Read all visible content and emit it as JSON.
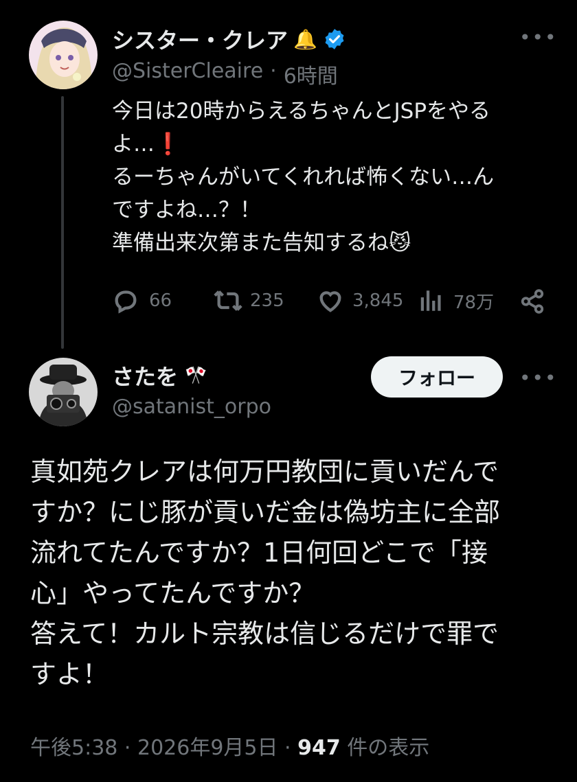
{
  "tweet1": {
    "author_name": "シスター・クレア",
    "name_emoji": "🔔",
    "verified": true,
    "handle": "@SisterCleaire",
    "separator": "·",
    "time": "6時間",
    "text_lines": [
      "今日は20時からえるちゃんとJSPをやる",
      "よ…❗",
      "るーちゃんがいてくれれば怖くない…ん",
      "ですよね…？！",
      "準備出来次第また告知するね😼"
    ],
    "stats": {
      "replies": "66",
      "retweets": "235",
      "likes": "3,845",
      "views": "78万"
    }
  },
  "tweet2": {
    "author_name": "さたを",
    "name_emoji": "🎌",
    "handle": "@satanist_orpo",
    "follow_label": "フォロー",
    "text_lines": [
      "真如苑クレアは何万円教団に貢いだんで",
      "すか？にじ豚が貢いだ金は偽坊主に全部",
      "流れてたんですか？1日何回どこで「接",
      "心」やってたんですか？",
      "答えて！カルト宗教は信じるだけで罪で",
      "すよ！"
    ],
    "timestamp": "午後5:38 · 2026年9月5日 ·",
    "view_count": "947",
    "view_suffix": "件の表示"
  },
  "colors": {
    "background": "#000000",
    "text": "#e7e9ea",
    "muted": "#71767b",
    "verified": "#1d9bf0",
    "follow_bg": "#eff3f4"
  }
}
